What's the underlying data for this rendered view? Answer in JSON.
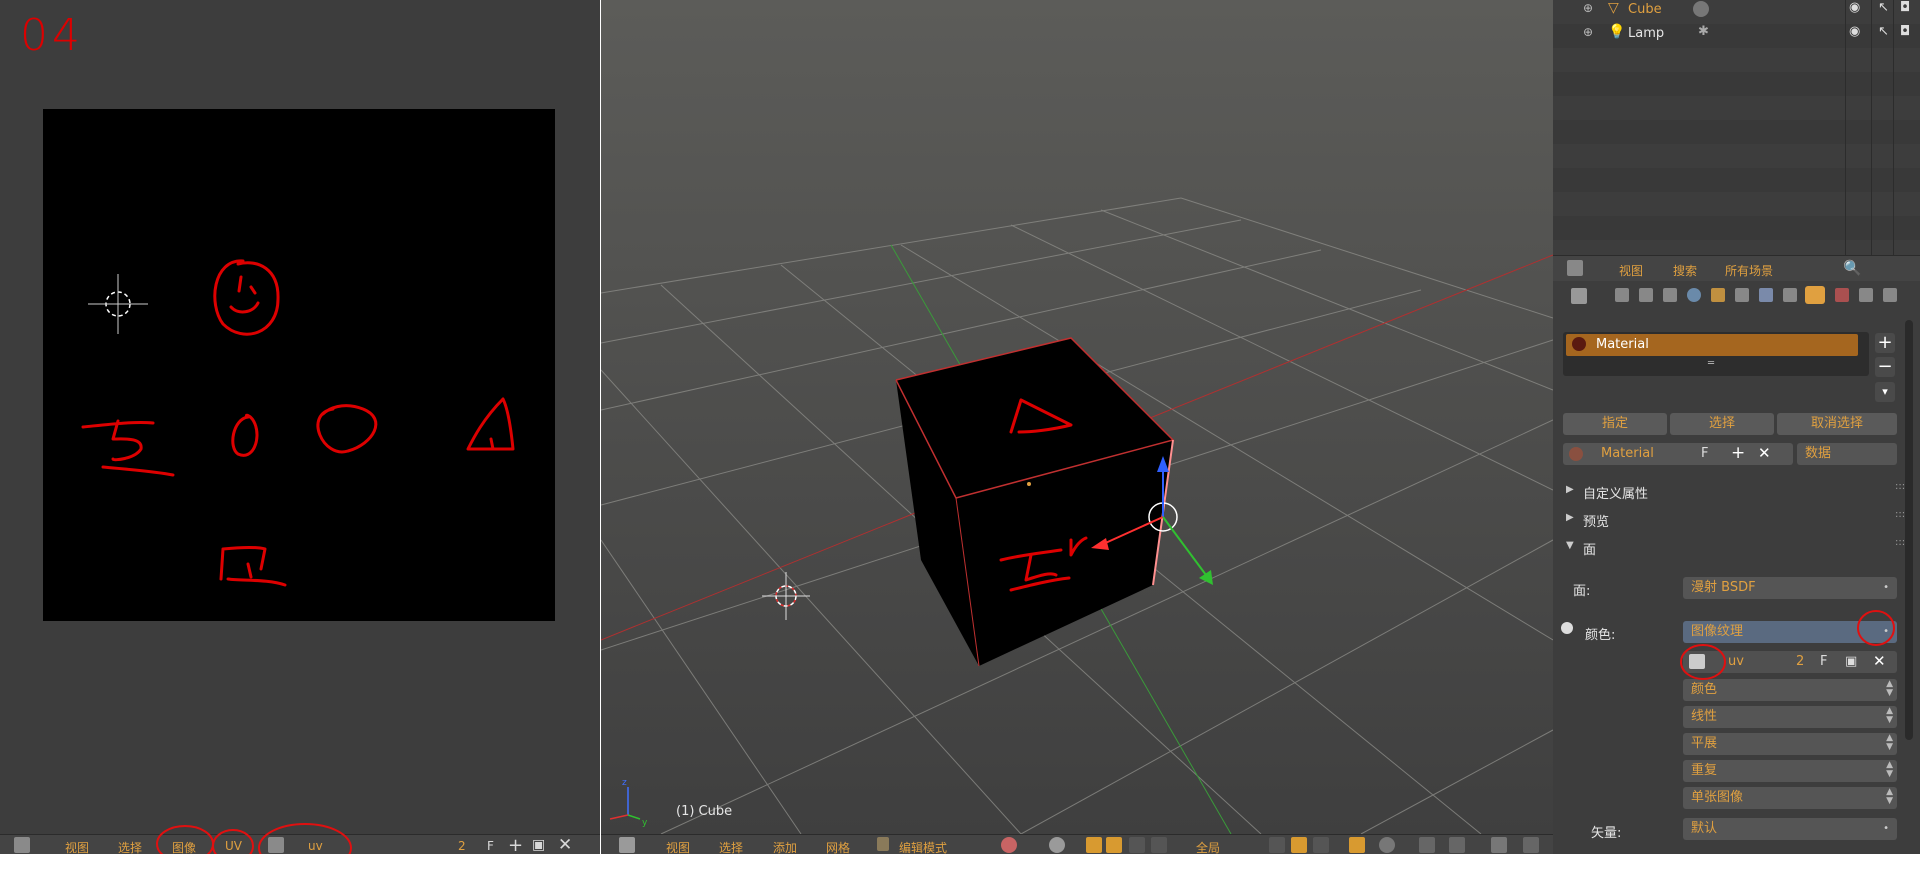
{
  "annotation": {
    "number": "04"
  },
  "uv_editor": {
    "header": {
      "view": "视图",
      "select": "选择",
      "image": "图像",
      "uv": "UV",
      "image_name": "uv",
      "users": "2",
      "fake": "F"
    }
  },
  "viewport": {
    "object_label": "(1) Cube",
    "header": {
      "view": "视图",
      "select": "选择",
      "add": "添加",
      "mesh": "网格",
      "mode": "编辑模式",
      "orientation": "全局"
    }
  },
  "outliner": {
    "items": [
      {
        "name": "Cube",
        "icon": "mesh-triangle-icon",
        "color": "#e0a040"
      },
      {
        "name": "Lamp",
        "icon": "lamp-icon",
        "color": "#e6e6e6"
      }
    ],
    "header": {
      "view": "视图",
      "search": "搜索",
      "scenes": "所有场景"
    }
  },
  "properties": {
    "slot": {
      "name": "Material"
    },
    "actions": {
      "assign": "指定",
      "select": "选择",
      "deselect": "取消选择"
    },
    "material_field": {
      "name": "Material",
      "fake": "F",
      "link": "数据"
    },
    "panels": {
      "custom_props": "自定义属性",
      "preview": "预览",
      "surface": "面"
    },
    "surface": {
      "surface_label": "面:",
      "surface_value": "漫射 BSDF",
      "color_label": "颜色:",
      "color_value": "图像纹理",
      "image_name": "uv",
      "image_users": "2",
      "image_fake": "F",
      "color_space": "颜色",
      "interpolation": "线性",
      "projection": "平展",
      "extension": "重复",
      "source": "单张图像",
      "vector_label": "矢量:",
      "vector_value": "默认"
    }
  },
  "colors": {
    "accent": "#e0a040",
    "annotation_red": "#dd0000",
    "selection": "#a5661f"
  }
}
